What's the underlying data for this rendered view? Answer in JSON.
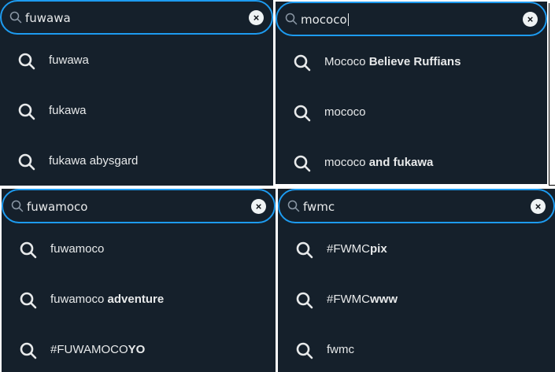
{
  "panels": [
    {
      "query": "fuwawa",
      "suggestions": [
        {
          "plain": "fuwawa",
          "bold": ""
        },
        {
          "plain": "fukawa",
          "bold": ""
        },
        {
          "plain": "fukawa abysgard",
          "bold": ""
        }
      ]
    },
    {
      "query": "mococo",
      "suggestions": [
        {
          "plain": "Mococo ",
          "bold": "Believe Ruffians"
        },
        {
          "plain": "mococo",
          "bold": ""
        },
        {
          "plain": "mococo ",
          "bold": "and fukawa"
        }
      ]
    },
    {
      "query": "fuwamoco",
      "suggestions": [
        {
          "plain": "fuwamoco",
          "bold": ""
        },
        {
          "plain": "fuwamoco ",
          "bold": "adventure"
        },
        {
          "plain": "#FUWAMOCO",
          "bold": "YO"
        }
      ]
    },
    {
      "query": "fwmc",
      "suggestions": [
        {
          "plain": "#FWMC",
          "bold": "pix"
        },
        {
          "plain": "#FWMC",
          "bold": "www"
        },
        {
          "plain": "fwmc",
          "bold": ""
        }
      ]
    }
  ],
  "icons": {
    "search": "search-icon",
    "clear": "clear-icon"
  },
  "colors": {
    "background": "#15202b",
    "accent": "#1d9bf0",
    "text": "#e7e9ea"
  }
}
